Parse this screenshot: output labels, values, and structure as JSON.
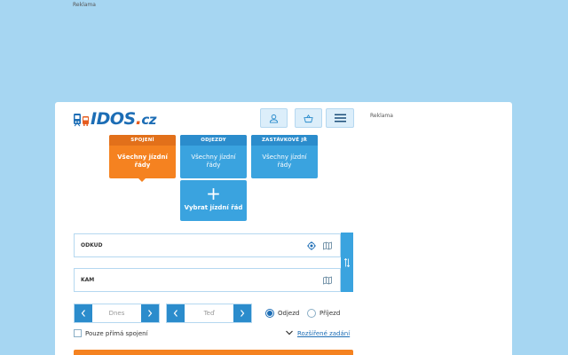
{
  "ads": {
    "top_label": "Reklama",
    "side_label": "Reklama"
  },
  "logo": {
    "text": "IDOS",
    "dot": ".",
    "suffix": "cz",
    "icon": "train-bus-icon"
  },
  "header": {
    "buttons": [
      {
        "name": "user",
        "icon": "user-icon"
      },
      {
        "name": "basket",
        "icon": "basket-icon"
      },
      {
        "name": "menu",
        "icon": "hamburger-icon"
      }
    ]
  },
  "tiles": {
    "spojeni": {
      "head": "SPOJENÍ",
      "body": "Všechny jízdní řády"
    },
    "odjezdy": {
      "head": "ODJEZDY",
      "body": "Všechny jízdní řády"
    },
    "zastavkove": {
      "head": "ZASTÁVKOVÉ JŘ",
      "body": "Všechny jízdní řády"
    },
    "vybrat": {
      "plus": "+",
      "label": "Vybrat jízdní řád"
    }
  },
  "form": {
    "odkud_label": "ODKUD",
    "kam_label": "KAM",
    "date_value": "Dnes",
    "time_value": "Teď",
    "radio_odjezd": "Odjezd",
    "radio_prijezd": "Příjezd",
    "selected_radio": "odjezd",
    "checkbox_label": "Pouze přímá spojení",
    "advanced_label": "Rozšířené zadání"
  },
  "colors": {
    "background": "#a6d6f2",
    "accent_blue": "#3aa3df",
    "accent_orange": "#f58220",
    "link_blue": "#1c6db5"
  }
}
